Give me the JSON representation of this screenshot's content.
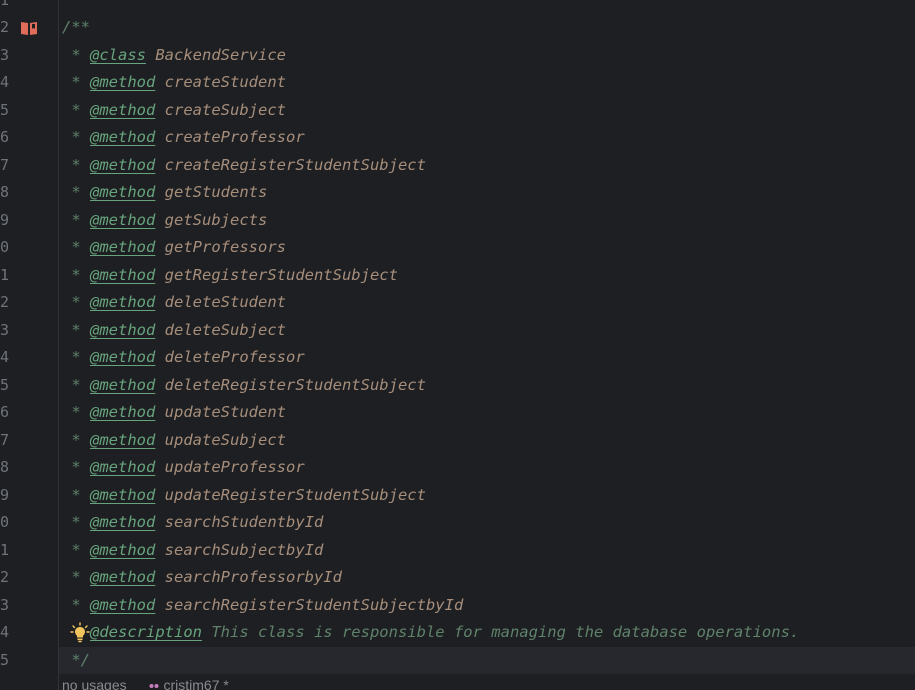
{
  "editor": {
    "line_numbers": [
      "1",
      "2",
      "3",
      "4",
      "5",
      "6",
      "7",
      "8",
      "9",
      "0",
      "1",
      "2",
      "3",
      "4",
      "5",
      "6",
      "7",
      "8",
      "9",
      "0",
      "1",
      "2",
      "3",
      "4",
      "5"
    ],
    "gutter_icon": "book-icon",
    "intention_icon": "lightbulb-icon",
    "open_comment": "/**",
    "close_comment": " */",
    "star": " * ",
    "class_tag": "@class",
    "class_name": "BackendService",
    "method_tag": "@method",
    "methods": [
      "createStudent",
      "createSubject",
      "createProfessor",
      "createRegisterStudentSubject",
      "getStudents",
      "getSubjects",
      "getProfessors",
      "getRegisterStudentSubject",
      "deleteStudent",
      "deleteSubject",
      "deleteProfessor",
      "deleteRegisterStudentSubject",
      "updateStudent",
      "updateSubject",
      "updateProfessor",
      "updateRegisterStudentSubject",
      "searchStudentbyId",
      "searchSubjectbyId",
      "searchProfessorbyId",
      "searchRegisterStudentSubjectbyId"
    ],
    "description_tag": "@description",
    "description_text": "This class is responsible for managing the database operations."
  },
  "footer": {
    "usages": "no usages",
    "author": "cristim67 *"
  }
}
